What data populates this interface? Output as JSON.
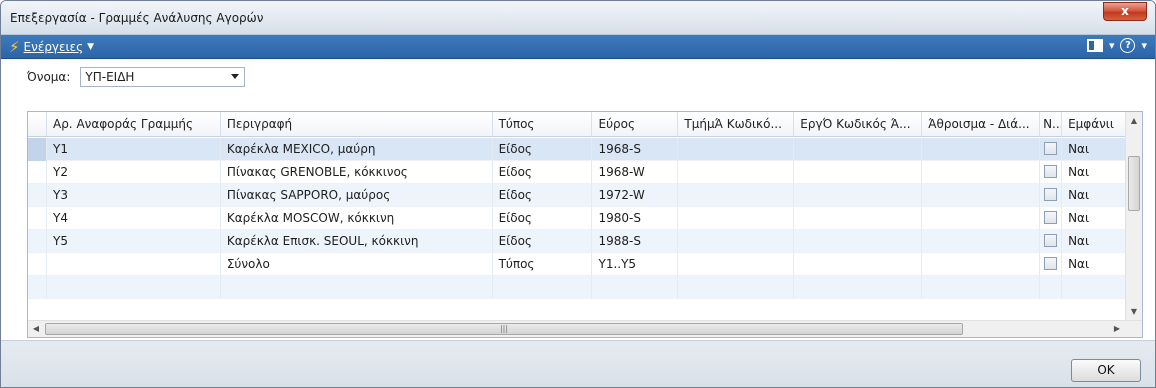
{
  "window": {
    "title": "Επεξεργασία - Γραμμές Ανάλυσης Αγορών",
    "close_label": "x"
  },
  "toolbar": {
    "actions_label": "Ενέργειες",
    "help_label": "?"
  },
  "filter": {
    "name_label": "Όνομα:",
    "name_value": "ΥΠ-ΕΙΔΗ"
  },
  "grid": {
    "columns": [
      "Αρ. Αναφοράς Γραμμής",
      "Περιγραφή",
      "Τύπος",
      "Εύρος",
      "ΤμήμΆ Κωδικό...",
      "ΕργΌ Κωδικός Ά...",
      "Άθροισμα - Διά...",
      "Ν...",
      "Εμφάνιι"
    ],
    "rows": [
      {
        "ref": "Υ1",
        "desc": "Καρέκλα MEXICO, μαύρη",
        "type": "Είδος",
        "range": "1968-S",
        "show": "Ναι"
      },
      {
        "ref": "Υ2",
        "desc": "Πίνακας GRENOBLE, κόκκινος",
        "type": "Είδος",
        "range": "1968-W",
        "show": "Ναι"
      },
      {
        "ref": "Υ3",
        "desc": "Πίνακας SAPPORO, μαύρος",
        "type": "Είδος",
        "range": "1972-W",
        "show": "Ναι"
      },
      {
        "ref": "Υ4",
        "desc": "Καρέκλα MOSCOW, κόκκινη",
        "type": "Είδος",
        "range": "1980-S",
        "show": "Ναι"
      },
      {
        "ref": "Υ5",
        "desc": "Καρέκλα Επισκ. SEOUL, κόκκινη",
        "type": "Είδος",
        "range": "1988-S",
        "show": "Ναι"
      },
      {
        "ref": "",
        "desc": "Σύνολο",
        "type": "Τύπος",
        "range": "Υ1..Υ5",
        "show": "Ναι"
      }
    ]
  },
  "footer": {
    "ok_label": "OK"
  }
}
